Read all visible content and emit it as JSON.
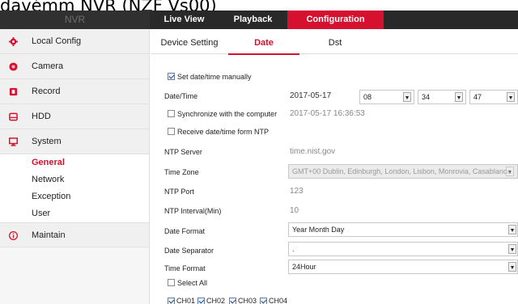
{
  "caption": "davémm NVR (NZF Vs00)",
  "topbar": {
    "brand": "NVR",
    "menu": [
      {
        "label": "Live View"
      },
      {
        "label": "Playback"
      },
      {
        "label": "Configuration",
        "active": true
      }
    ],
    "accent_color": "#d6112f"
  },
  "sidebar": {
    "groups": [
      {
        "label": "Local Config",
        "icon": "gear-icon"
      },
      {
        "label": "Camera",
        "icon": "camera-icon"
      },
      {
        "label": "Record",
        "icon": "record-icon"
      },
      {
        "label": "HDD",
        "icon": "hdd-icon"
      },
      {
        "label": "System",
        "icon": "monitor-icon"
      }
    ],
    "system_items": [
      {
        "label": "General",
        "active": true
      },
      {
        "label": "Network"
      },
      {
        "label": "Exception"
      },
      {
        "label": "User"
      }
    ],
    "maintain": {
      "label": "Maintain",
      "icon": "info-icon"
    }
  },
  "tabs": [
    {
      "label": "Device Setting"
    },
    {
      "label": "Date",
      "active": true
    },
    {
      "label": "Dst"
    }
  ],
  "form": {
    "set_manually": {
      "label": "Set date/time manually",
      "checked": true
    },
    "datetime": {
      "label": "Date/Time",
      "date": "2017-05-17",
      "hour": "08",
      "minute": "34",
      "second": "47"
    },
    "sync_computer": {
      "label": "Synchronize with the computer",
      "checked": false,
      "value": "2017-05-17 16:36:53"
    },
    "receive_ntp": {
      "label": "Receive date/time form NTP",
      "checked": false
    },
    "ntp_server": {
      "label": "NTP Server",
      "value": "time.nist.gov"
    },
    "time_zone": {
      "label": "Time Zone",
      "value": "GMT+00 Dublin, Edinburgh, London, Lisbon, Monrovia, Casablanca"
    },
    "ntp_port": {
      "label": "NTP Port",
      "value": "123"
    },
    "ntp_interval": {
      "label": "NTP Interval(Min)",
      "value": "10"
    },
    "date_format": {
      "label": "Date Format",
      "value": "Year Month Day"
    },
    "date_separator": {
      "label": "Date Separator",
      "value": "."
    },
    "time_format": {
      "label": "Time Format",
      "value": "24Hour"
    },
    "select_all": {
      "label": "Select All",
      "checked": false
    },
    "channels": [
      {
        "label": "CH01",
        "checked": true
      },
      {
        "label": "CH02",
        "checked": true
      },
      {
        "label": "CH03",
        "checked": true
      },
      {
        "label": "CH04",
        "checked": true
      }
    ]
  }
}
